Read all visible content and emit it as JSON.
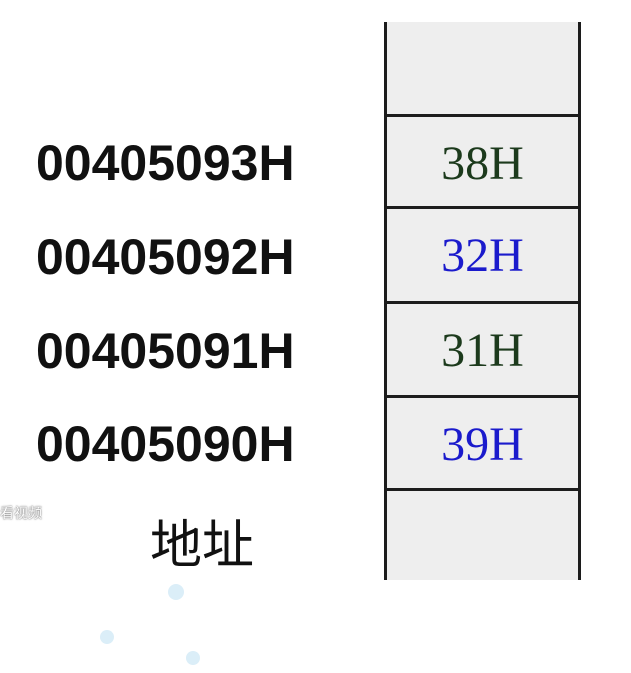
{
  "addresses": [
    "00405093H",
    "00405092H",
    "00405091H",
    "00405090H"
  ],
  "address_caption": "地址",
  "cells": [
    {
      "value": "",
      "color": "#1c3a1c"
    },
    {
      "value": "38H",
      "color": "#1c3a1c"
    },
    {
      "value": "32H",
      "color": "#1a1acc"
    },
    {
      "value": "31H",
      "color": "#1c3a1c"
    },
    {
      "value": "39H",
      "color": "#1a1acc"
    },
    {
      "value": "",
      "color": "#1c3a1c"
    }
  ],
  "watermark": "看视频"
}
